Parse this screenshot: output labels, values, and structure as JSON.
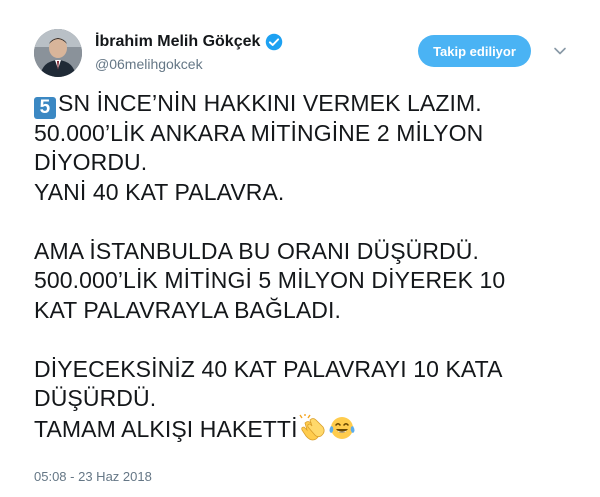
{
  "user": {
    "name": "İbrahim Melih Gökçek",
    "handle": "@06melihgokcek",
    "verified": true
  },
  "follow_button": {
    "label": "Takip ediliyor"
  },
  "tweet": {
    "keycap": "5",
    "lines": [
      "SN İNCE’NİN HAKKINI VERMEK LAZIM.",
      "50.000’LİK ANKARA MİTİNGİNE 2 MİLYON",
      "DİYORDU.",
      "YANİ 40 KAT PALAVRA.",
      "",
      "AMA İSTANBULDA BU ORANI DÜŞÜRDÜ.",
      "500.000’LİK MİTİNGİ 5 MİLYON DİYEREK 10",
      "KAT PALAVRAYLA BAĞLADI.",
      "",
      "DİYECEKSİNİZ 40 KAT PALAVRAYI 10 KATA",
      "DÜŞÜRDÜ.",
      "TAMAM ALKIŞI HAKETTİ"
    ],
    "emojis": [
      "clapping-hands-icon",
      "tears-of-joy-icon"
    ]
  },
  "meta": {
    "time": "05:08",
    "separator": " - ",
    "date": "23 Haz 2018"
  },
  "colors": {
    "accent": "#4ab3f4",
    "verified": "#1da1f2",
    "text": "#14171a",
    "muted": "#657786",
    "keycap": "#3b88c3"
  }
}
